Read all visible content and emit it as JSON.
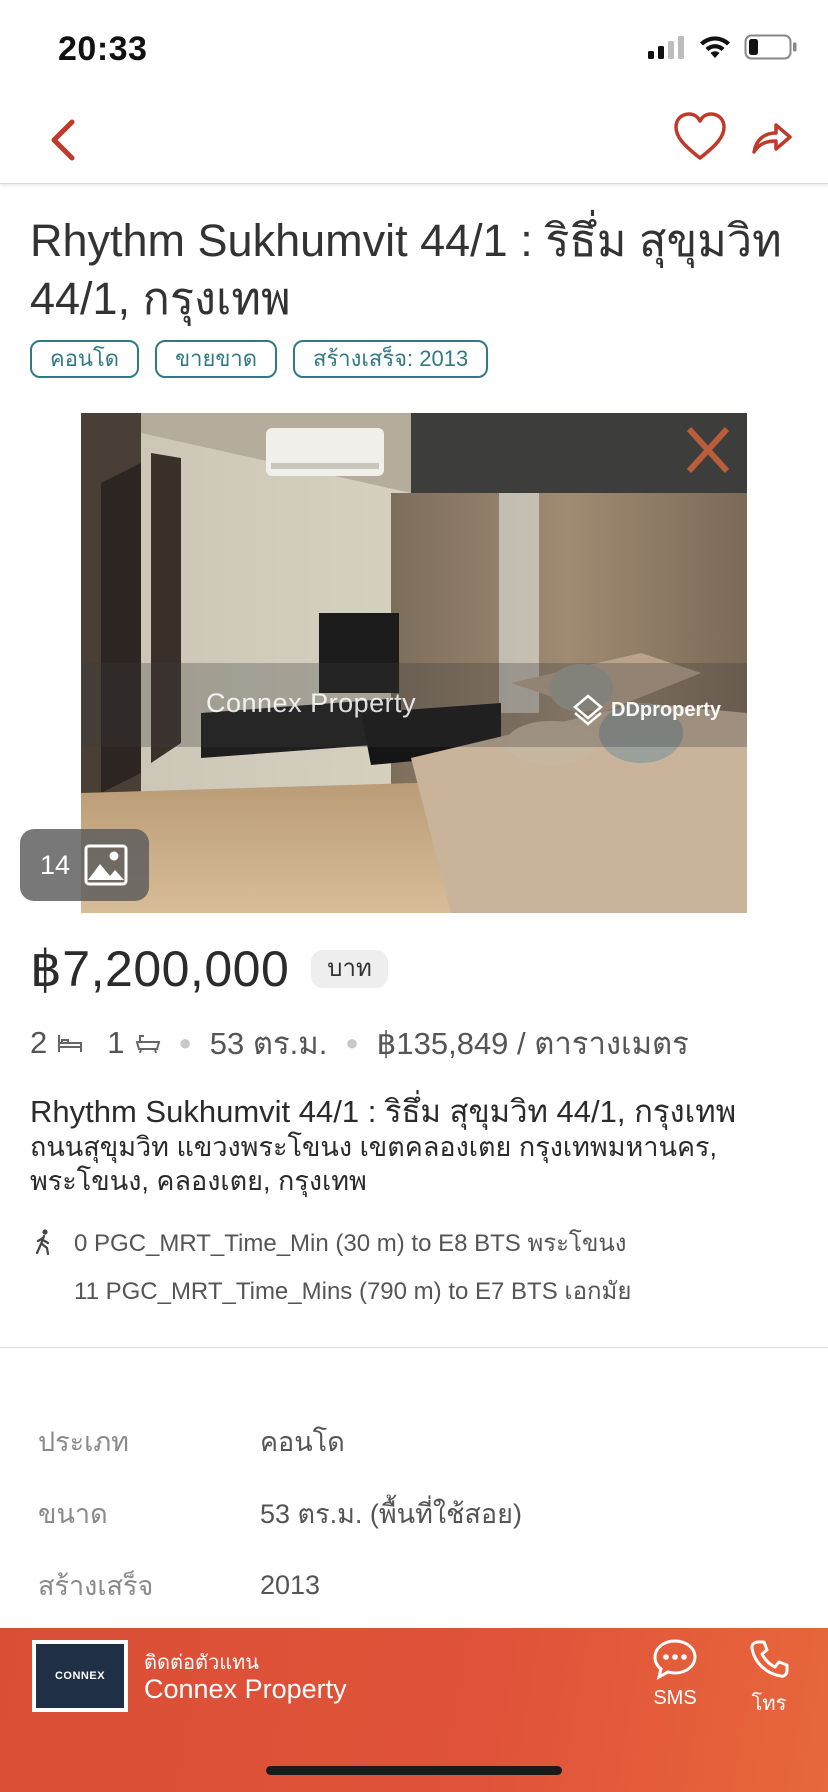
{
  "status_bar": {
    "time": "20:33"
  },
  "nav": {
    "back_icon": "chevron-left-icon",
    "favorite_icon": "heart-icon",
    "share_icon": "share-icon",
    "accent_color": "#c0392b"
  },
  "listing": {
    "title": "Rhythm Sukhumvit 44/1 : ริธึ่ม สุขุมวิท 44/1, กรุงเทพ",
    "tags": [
      "คอนโด",
      "ขายขาด",
      "สร้างเสร็จ: 2013"
    ],
    "photo": {
      "count": "14",
      "watermark_left": "Connex Property",
      "watermark_right": "DDproperty"
    },
    "price": "฿7,200,000",
    "currency": "บาท",
    "specs": {
      "bedrooms": "2",
      "bathrooms": "1",
      "area": "53 ตร.ม.",
      "price_per_sqm": "฿135,849 / ตารางเมตร"
    },
    "address_title": "Rhythm Sukhumvit 44/1 : ริธึ่ม สุขุมวิท 44/1, กรุงเทพ",
    "address_detail": "ถนนสุขุมวิท แขวงพระโขนง เขตคลองเตย กรุงเทพมหานคร, พระโขนง, คลองเตย, กรุงเทพ",
    "transit": [
      "0 PGC_MRT_Time_Min (30 m) to E8 BTS พระโขนง",
      "11 PGC_MRT_Time_Mins (790 m) to E7 BTS เอกมัย"
    ]
  },
  "details": [
    {
      "label": "ประเภท",
      "value": "คอนโด"
    },
    {
      "label": "ขนาด",
      "value": "53 ตร.ม. (พื้นที่ใช้สอย)"
    },
    {
      "label": "สร้างเสร็จ",
      "value": "2013"
    }
  ],
  "footer": {
    "agent_caption": "ติดต่อตัวแทน",
    "agent_name": "Connex Property",
    "agent_logo_text": "CONNEX",
    "sms_label": "SMS",
    "call_label": "โทร"
  },
  "colors": {
    "tag": "#2f7a86",
    "footer": "#dd5038"
  }
}
